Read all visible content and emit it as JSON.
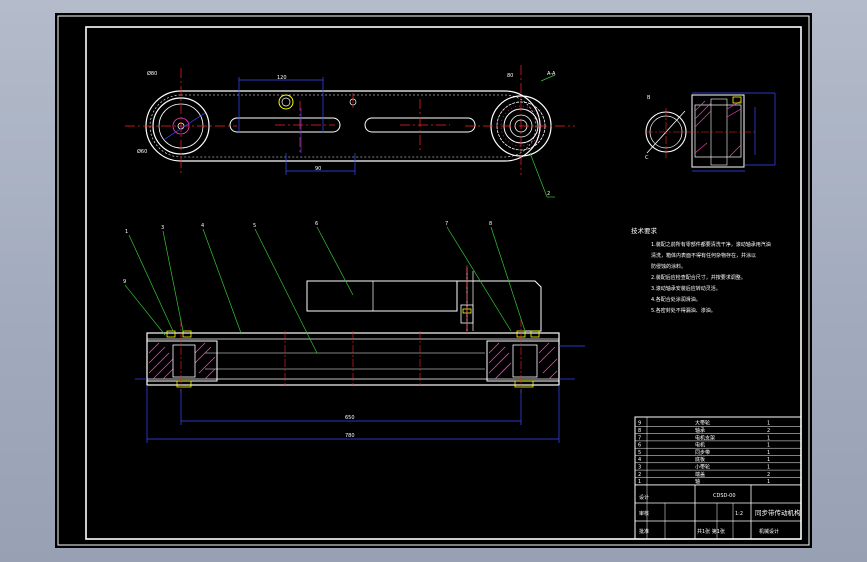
{
  "drawing": {
    "notes_title": "技术要求",
    "notes": [
      "1.装配之前所有零部件都要清洗干净，滚动轴承用汽油",
      "清洗，箱体内表面不得有任何杂物存在，并涂以",
      "防侵蚀的涂料。",
      "2.装配后应检查配合尺寸，并按要求调整。",
      "3.滚动轴承安装后应转动灵活。",
      "4.各配合处涂润滑油。",
      "5.各密封处不得漏油、渗油。"
    ],
    "part_labels": [
      "1",
      "2",
      "3",
      "4",
      "5",
      "6",
      "7",
      "8",
      "9"
    ],
    "section_labels": [
      "A-A",
      "B",
      "C"
    ],
    "dimensions": [
      "Ø80",
      "Ø60",
      "120",
      "90",
      "80",
      "650",
      "780"
    ],
    "title_block": {
      "name": "同步带传动机构",
      "code": "CDSD-00",
      "scale": "1:2",
      "sheet": "共1张 第1张",
      "school": "机械设计",
      "drawn": "设计",
      "checked": "审核",
      "approved": "批准",
      "rows": [
        {
          "no": "9",
          "name": "大带轮",
          "qty": "1"
        },
        {
          "no": "8",
          "name": "轴承",
          "qty": "2"
        },
        {
          "no": "7",
          "name": "电机支架",
          "qty": "1"
        },
        {
          "no": "6",
          "name": "电机",
          "qty": "1"
        },
        {
          "no": "5",
          "name": "同步带",
          "qty": "1"
        },
        {
          "no": "4",
          "name": "底板",
          "qty": "1"
        },
        {
          "no": "3",
          "name": "小带轮",
          "qty": "1"
        },
        {
          "no": "2",
          "name": "端盖",
          "qty": "2"
        },
        {
          "no": "1",
          "name": "轴",
          "qty": "1"
        }
      ]
    }
  },
  "colors": {
    "background": "#000000",
    "frame": "#ffffff",
    "centerline": "#ff2020",
    "dimension": "#3a4dff",
    "leader": "#32c832",
    "hatch": "#ff40c0",
    "cyan": "#00e0e0",
    "yellow": "#ffff00"
  }
}
